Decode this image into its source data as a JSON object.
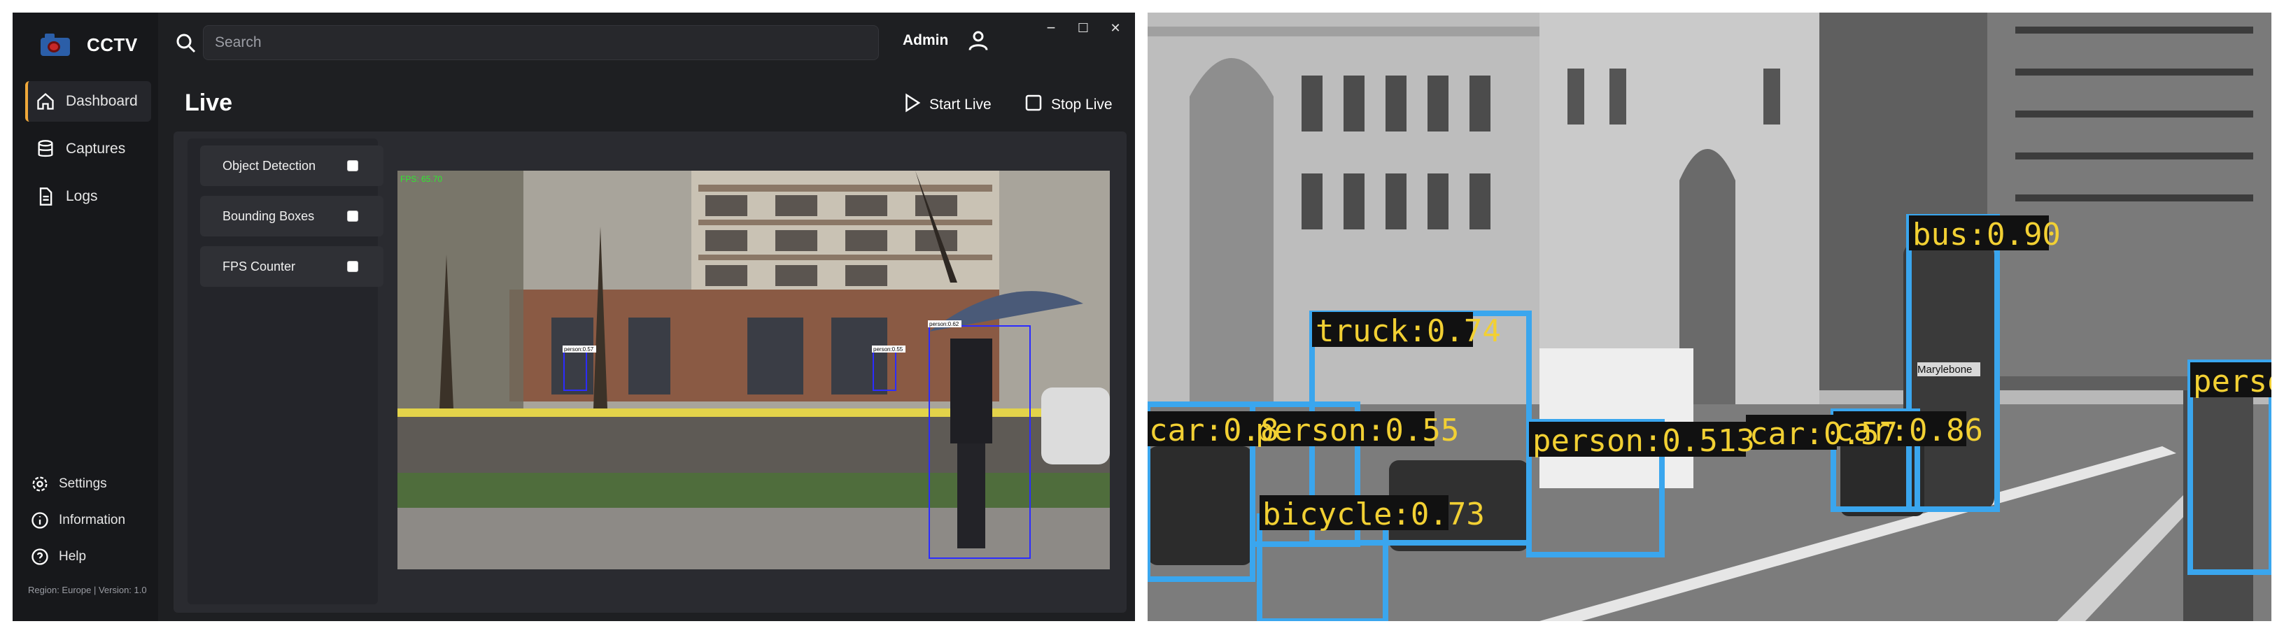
{
  "app": {
    "title": "CCTV",
    "search": {
      "placeholder": "Search"
    },
    "user": {
      "name": "Admin"
    },
    "window_controls": {
      "minimize": "−",
      "maximize": "☐",
      "close": "✕"
    },
    "nav": [
      {
        "label": "Dashboard",
        "icon": "home-icon",
        "active": true
      },
      {
        "label": "Captures",
        "icon": "database-icon"
      },
      {
        "label": "Logs",
        "icon": "document-icon"
      }
    ],
    "bottom_nav": [
      {
        "label": "Settings",
        "icon": "gear-icon"
      },
      {
        "label": "Information",
        "icon": "info-icon"
      },
      {
        "label": "Help",
        "icon": "help-icon"
      }
    ],
    "footer": "Region: Europe | Version: 1.0",
    "page_title": "Live",
    "actions": {
      "start": "Start Live",
      "stop": "Stop Live"
    },
    "options": [
      {
        "label": "Object Detection",
        "checked": false
      },
      {
        "label": "Bounding Boxes",
        "checked": false
      },
      {
        "label": "FPS Counter",
        "checked": false
      }
    ],
    "video_overlay": {
      "fps": "FPS: 65.70",
      "labels": [
        "person:0.57",
        "person:0.55",
        "person:0.62"
      ]
    },
    "accent_color": "#f0a83a"
  },
  "detections": {
    "box_color": "#3aa6ee",
    "label_color": "#f2d033",
    "labels": [
      "bus:0.90",
      "truck:0.74",
      "car:0.8",
      "person:0.55",
      "person:0.513",
      "car:0.57",
      "car:0.86",
      "bicycle:0.73",
      "perso"
    ],
    "sign_text": "Marylebone"
  }
}
